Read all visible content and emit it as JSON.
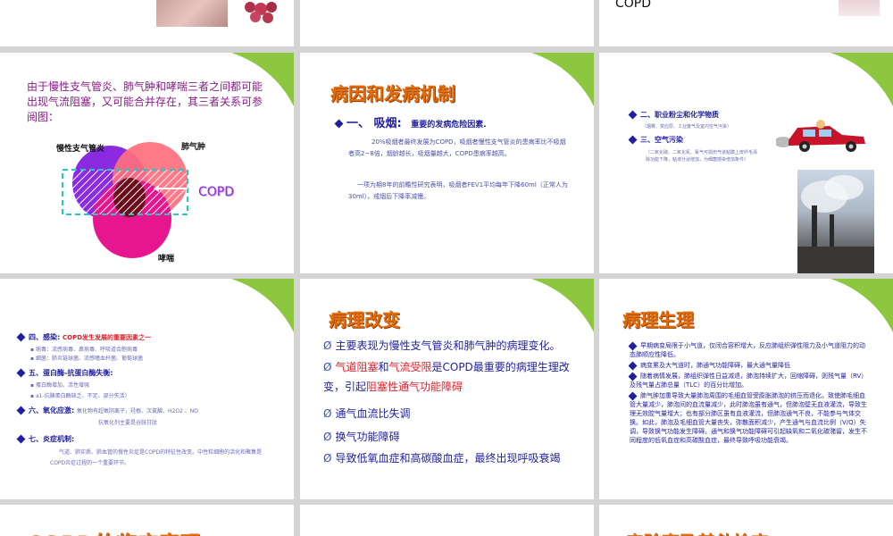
{
  "slide3": {
    "text": "COPD"
  },
  "slide4": {
    "text": "由于慢性支气管炎、肺气肿和哮喘三者之间都可能出现气流阻塞，又可能合并存在，其三者关系可参阅图：",
    "labels": {
      "bronchitis": "慢性支气管炎",
      "emphysema": "肺气肿",
      "asthma": "哮喘",
      "copd": "COPD"
    },
    "colors": {
      "bronchitis": "#8a2be2",
      "emphysema": "#ff6f7d",
      "asthma": "#e6168f",
      "dash": "#27c4c8"
    }
  },
  "slide5": {
    "title": "病因和发病机制",
    "h1_num": "一、",
    "h1_label": "吸烟:",
    "h1_sub": "重要的发病危险因素.",
    "p1": "20%吸烟者最终发展为COPD，吸烟者慢性支气管炎的患病率比不吸烟者高2~8倍，烟龄越长，吸烟量越大，COPD患病率越高。",
    "p2": "一项为期8年的前瞻性研究表明，吸烟者FEV1平均每年下降60ml（正常人为30ml），戒烟后下降率减慢。"
  },
  "slide6": {
    "h2": "二、职业粉尘和化学物质",
    "h2_sub": "（烟雾、变应原、工业废气及室内空气污染）",
    "h3": "三、空气污染",
    "h3_sub": "（二氧化硫、二氧化氮、氯气可损伤气道粘膜上皮纤毛清除功能下降，粘液分泌增加，为细菌感染增加条件）"
  },
  "slide7": {
    "h4": "四、感染:",
    "h4_sub": "COPD发生发展的重要因素之一",
    "h4_b1": "病毒：流感病毒、鼻病毒、呼吸道合胞病毒",
    "h4_b2": "细菌：肺炎链球菌、流感嗜血杆菌、葡萄球菌",
    "h5": "五、蛋白酶-抗蛋白酶失衡:",
    "h5_b1": "蛋白酶增加，活性增强",
    "h5_b2": "a1-抗胰蛋白酶缺乏、不足、部分失活）",
    "h6": "六、氧化应激:",
    "h6_text": "氧化物有超氧阴离子，羟根、次氯酸、H2O2 、NO",
    "h6_text2": "抗氧化剂主要是谷胱甘肽",
    "h7": "七、炎症机制:",
    "h7_text": "气道、肺实质、肺血管的慢性炎症是COPD的特征性改变。中性粒细胞的活化和聚集是COPD炎症过程的一个重要环节。"
  },
  "slide8": {
    "title": "病理改变",
    "b1": "主要表现为慢性支气管炎和肺气肿的病理变化。",
    "b2a": "气道阻塞",
    "b2b": "和",
    "b2c": "气流受限",
    "b2d": "是COPD最重要的病理生理改变，引起",
    "b2e": "阻塞性通气功能障碍",
    "b3": "通气血流比失调",
    "b4": "换气功能障碍",
    "b5": "导致低氧血症和高碳酸血症，最终出现呼吸衰竭",
    "bullet": "Ø"
  },
  "slide9": {
    "title": "病理生理",
    "p1": "早期病变局限于小气道，仅闭合容积增大，反应肺组织弹性阻力及小气道阻力的动态肺顺应性降低。",
    "p2": "病变累及大气道时，肺通气功能障碍，最大通气量降低",
    "p3": "随着病情发展，肺组织弹性日益减退，肺泡持续扩大，回缩障碍，则残气量（RV）及残气量占肺总量（TLC）的百分比增加。",
    "p4": "肺气肿加重导致大量肺泡周围的毛细血管受膨胀肺泡的挤压而退化，致使肺毛细血管大量减少，肺泡间的血流量减少，此时肺泡虽有通气，但肺泡壁无血液灌流，导致生理无效腔气量增大；也有部分肺区虽有血液灌流，但肺泡通气不良，不能参与气体交换。如此，肺泡及毛细血管大量丧失，弥散面积减少，产生通气与血流比例（V/Q）失调，导致换气功能发生障碍。通气和换气功能障碍可引起缺氧和二氧化碳潴留，发生不同程度的低氧血症和高碳酸血症，最终导致呼吸功能衰竭。"
  },
  "slide10": {
    "title": "COPD的临床表现"
  },
  "slide12": {
    "title": "实验室及其他检查"
  }
}
